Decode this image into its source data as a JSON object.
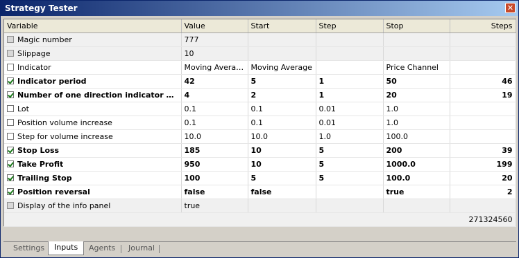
{
  "window": {
    "title": "Strategy Tester",
    "close_symbol": "✕"
  },
  "columns": [
    "Variable",
    "Value",
    "Start",
    "Step",
    "Stop",
    "Steps"
  ],
  "rows": [
    {
      "checked": false,
      "disabled": true,
      "bold": false,
      "variable": "Magic number",
      "value": "777",
      "start": "",
      "step": "",
      "stop": "",
      "steps": ""
    },
    {
      "checked": false,
      "disabled": true,
      "bold": false,
      "variable": "Slippage",
      "value": "10",
      "start": "",
      "step": "",
      "stop": "",
      "steps": ""
    },
    {
      "checked": false,
      "disabled": false,
      "bold": false,
      "variable": "Indicator",
      "value": "Moving Average",
      "start": "Moving Average",
      "step": "",
      "stop": "Price Channel",
      "steps": ""
    },
    {
      "checked": true,
      "disabled": false,
      "bold": true,
      "variable": "Indicator period",
      "value": "42",
      "start": "5",
      "step": "1",
      "stop": "50",
      "steps": "46"
    },
    {
      "checked": true,
      "disabled": false,
      "bold": true,
      "variable": "Number of one direction indicator segm...",
      "value": "4",
      "start": "2",
      "step": "1",
      "stop": "20",
      "steps": "19"
    },
    {
      "checked": false,
      "disabled": false,
      "bold": false,
      "variable": "Lot",
      "value": "0.1",
      "start": "0.1",
      "step": "0.01",
      "stop": "1.0",
      "steps": ""
    },
    {
      "checked": false,
      "disabled": false,
      "bold": false,
      "variable": "Position volume increase",
      "value": "0.1",
      "start": "0.1",
      "step": "0.01",
      "stop": "1.0",
      "steps": ""
    },
    {
      "checked": false,
      "disabled": false,
      "bold": false,
      "variable": "Step for volume increase",
      "value": "10.0",
      "start": "10.0",
      "step": "1.0",
      "stop": "100.0",
      "steps": ""
    },
    {
      "checked": true,
      "disabled": false,
      "bold": true,
      "variable": "Stop Loss",
      "value": "185",
      "start": "10",
      "step": "5",
      "stop": "200",
      "steps": "39"
    },
    {
      "checked": true,
      "disabled": false,
      "bold": true,
      "variable": "Take Profit",
      "value": "950",
      "start": "10",
      "step": "5",
      "stop": "1000.0",
      "steps": "199"
    },
    {
      "checked": true,
      "disabled": false,
      "bold": true,
      "variable": "Trailing Stop",
      "value": "100",
      "start": "5",
      "step": "5",
      "stop": "100.0",
      "steps": "20"
    },
    {
      "checked": true,
      "disabled": false,
      "bold": true,
      "variable": "Position reversal",
      "value": "false",
      "start": "false",
      "step": "",
      "stop": "true",
      "steps": "2"
    },
    {
      "checked": false,
      "disabled": true,
      "bold": false,
      "variable": "Display of the info panel",
      "value": "true",
      "start": "",
      "step": "",
      "stop": "",
      "steps": ""
    }
  ],
  "total_steps": "271324560",
  "tabs": [
    "Settings",
    "Inputs",
    "Agents",
    "Journal"
  ],
  "active_tab": "Inputs",
  "colors": {
    "title_start": "#0a246a",
    "title_end": "#a6caf0",
    "check": "#1a7a1a",
    "alt_row": "#f0f0f0"
  }
}
